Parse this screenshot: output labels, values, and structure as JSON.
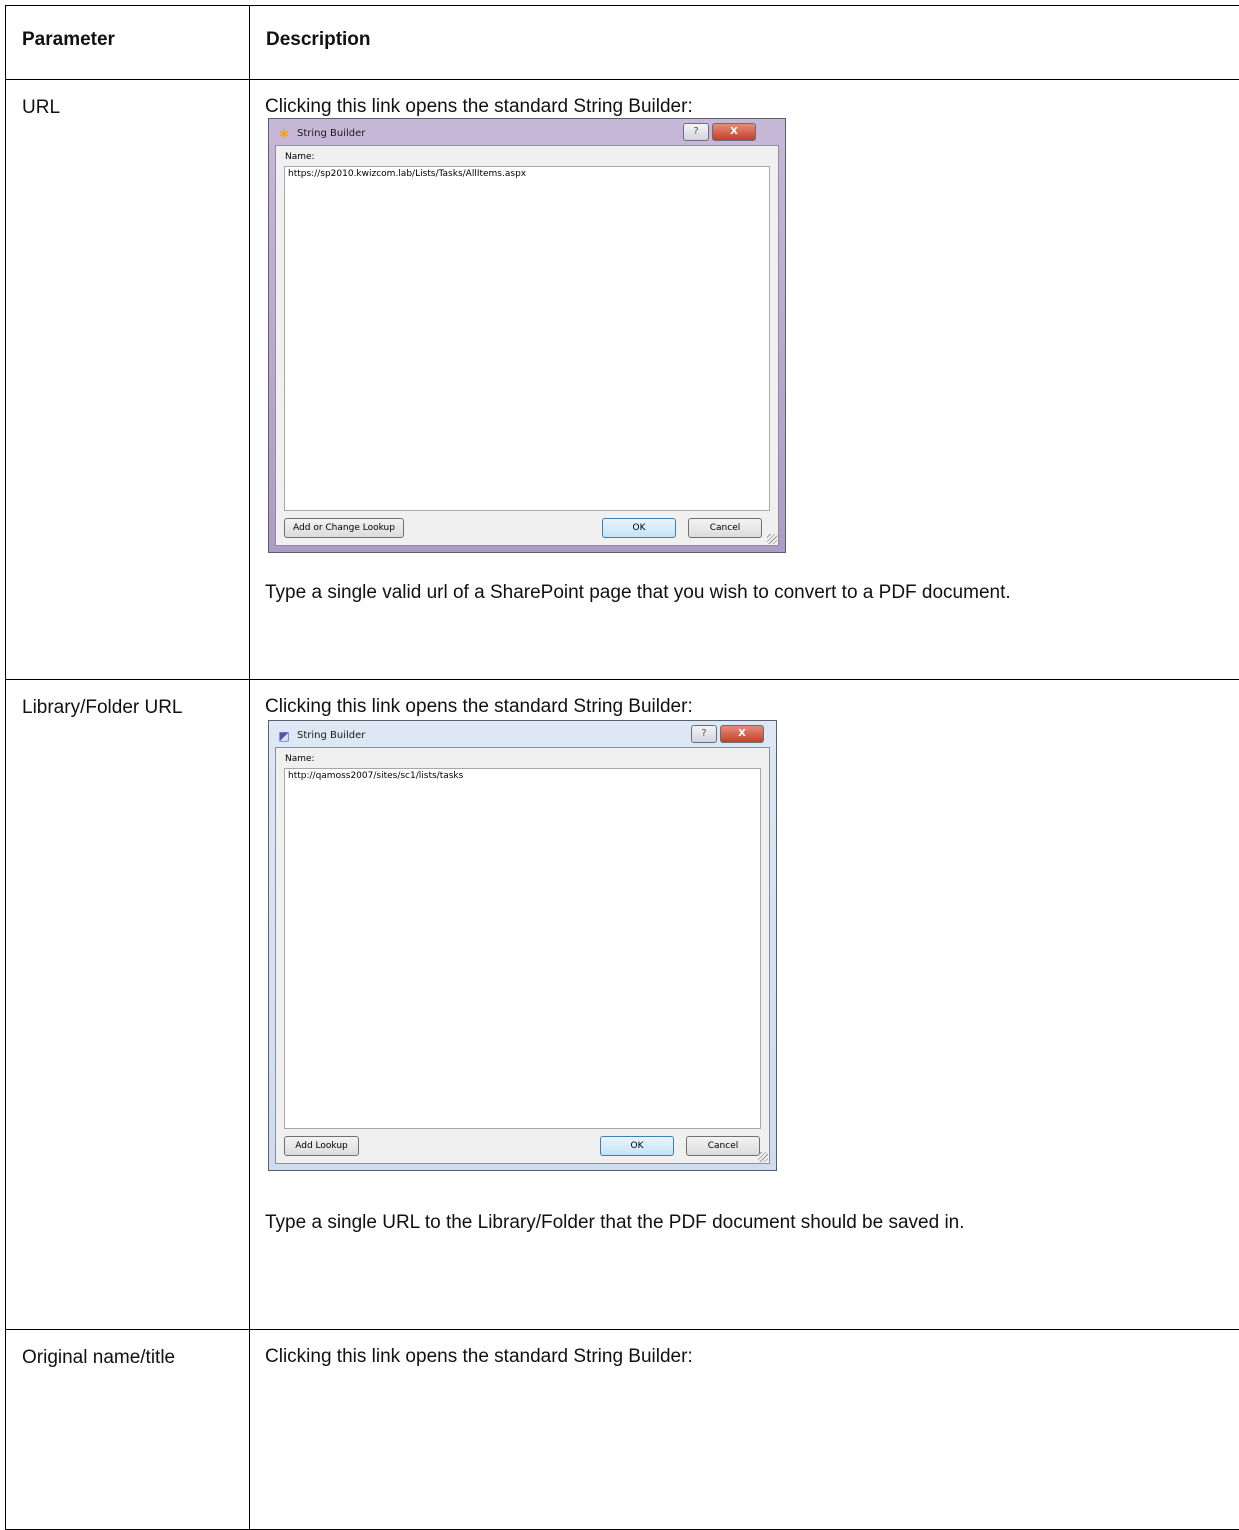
{
  "table": {
    "headers": {
      "parameter": "Parameter",
      "description": "Description"
    },
    "rows": [
      {
        "parameter": "URL",
        "intro": "Clicking this link opens the standard String Builder:",
        "dialog": {
          "title": "String Builder",
          "help_glyph": "?",
          "close_glyph": "X",
          "field_label": "Name:",
          "field_value": "https://sp2010.kwizcom.lab/Lists/Tasks/AllItems.aspx",
          "lookup_button": "Add or Change Lookup",
          "ok_button": "OK",
          "cancel_button": "Cancel"
        },
        "footer": "Type a single valid url of a SharePoint page that you wish to convert to a PDF document."
      },
      {
        "parameter": "Library/Folder URL",
        "intro": "Clicking this link opens the standard String Builder:",
        "dialog": {
          "title": "String Builder",
          "help_glyph": "?",
          "close_glyph": "X",
          "field_label": "Name:",
          "field_value": "http://qamoss2007/sites/sc1/lists/tasks",
          "lookup_button": "Add Lookup",
          "ok_button": "OK",
          "cancel_button": "Cancel"
        },
        "footer": "Type a single URL to the Library/Folder that the PDF document should be saved in."
      },
      {
        "parameter": "Original name/title",
        "intro": "Clicking this link opens the standard String Builder:"
      }
    ]
  }
}
